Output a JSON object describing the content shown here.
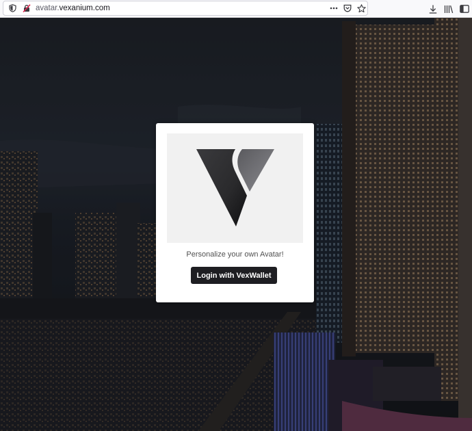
{
  "browser": {
    "url_prefix": "avatar.",
    "url_domain": "vexanium.com",
    "icons": {
      "shield": "shield-icon",
      "connection": "insecure-connection-icon",
      "more": "more-actions-icon",
      "pocket": "pocket-icon",
      "bookmark": "bookmark-star-icon",
      "download": "download-icon",
      "library": "library-icon",
      "sidebar": "sidebar-icon"
    }
  },
  "card": {
    "logo": "vexanium-v-logo",
    "tagline": "Personalize your own Avatar!",
    "login_label": "Login with VexWallet"
  },
  "colors": {
    "button_bg": "#1e1e22",
    "panel_bg": "#f1f1f1",
    "page_bg": "#1a1d24"
  }
}
